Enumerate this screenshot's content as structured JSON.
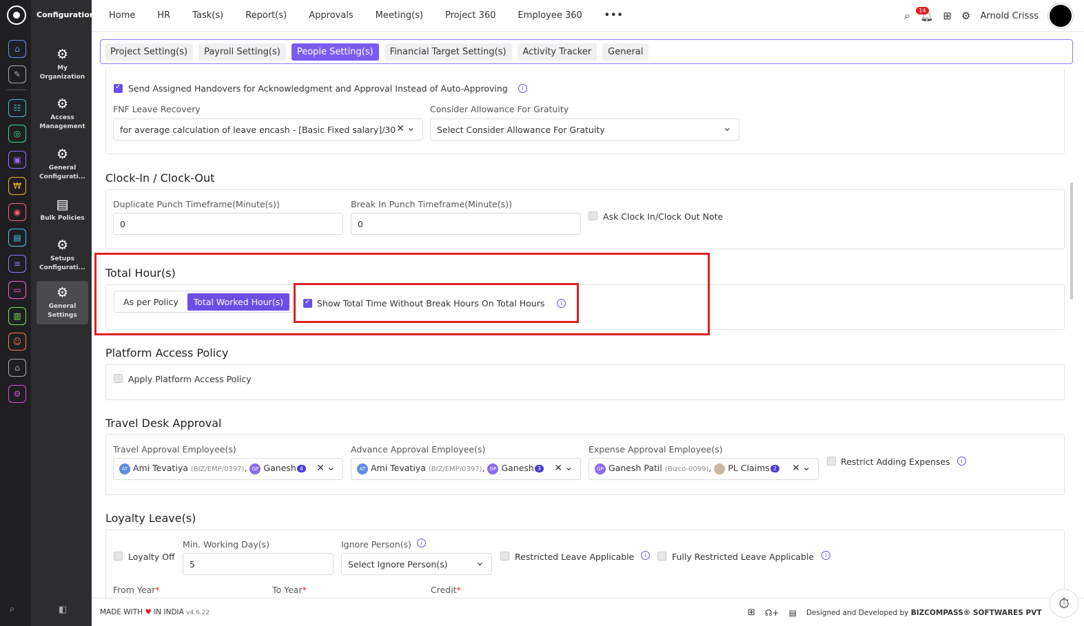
{
  "sidebar": {
    "title": "Configuration",
    "items": [
      {
        "label": "My Organization",
        "icon": "org-gear-icon"
      },
      {
        "label": "Access Management",
        "icon": "gear-icon"
      },
      {
        "label": "General Configurati...",
        "icon": "gear-icon"
      },
      {
        "label": "Bulk Policies",
        "icon": "document-gear-icon"
      },
      {
        "label": "Setups Configurati...",
        "icon": "gear-icon"
      },
      {
        "label": "General Settings",
        "icon": "org-gear-icon"
      }
    ]
  },
  "topnav": {
    "links": [
      "Home",
      "HR",
      "Task(s)",
      "Report(s)",
      "Approvals",
      "Meeting(s)",
      "Project 360",
      "Employee 360"
    ],
    "more": "•••",
    "notification_count": "14",
    "user_name": "Arnold Crisss"
  },
  "tabs": [
    "Project Setting(s)",
    "Payroll Setting(s)",
    "People Setting(s)",
    "Financial Target Setting(s)",
    "Activity Tracker",
    "General"
  ],
  "handover": {
    "send_assigned_label": "Send Assigned Handovers for Acknowledgment and Approval Instead of Auto-Approving",
    "fnf_label": "FNF Leave Recovery",
    "fnf_value": "for average calculation of leave encash - [Basic Fixed salary]/30",
    "gratuity_label": "Consider Allowance For Gratuity",
    "gratuity_placeholder": "Select Consider Allowance For Gratuity"
  },
  "clock": {
    "title": "Clock-In / Clock-Out",
    "dup_label": "Duplicate Punch Timeframe(Minute(s))",
    "dup_value": "0",
    "break_label": "Break In Punch Timeframe(Minute(s))",
    "break_value": "0",
    "ask_note_label": "Ask Clock In/Clock Out Note"
  },
  "total_hours": {
    "title": "Total Hour(s)",
    "option_policy": "As per Policy",
    "option_worked": "Total Worked Hour(s)",
    "show_total_label": "Show Total Time Without Break Hours On Total Hours"
  },
  "platform": {
    "title": "Platform Access Policy",
    "apply_label": "Apply Platform Access Policy"
  },
  "travel": {
    "title": "Travel Desk Approval",
    "travel_label": "Travel Approval Employee(s)",
    "advance_label": "Advance Approval Employee(s)",
    "expense_label": "Expense Approval Employee(s)",
    "emp1_initials": "AT",
    "emp1_name": "Ami Tevatiya",
    "emp1_code": "(BIZ/EMP/0397)",
    "emp2_initials": "GP",
    "emp2_name": "Ganesh",
    "travel_count": "4",
    "advance_count": "3",
    "exp1_name": "Ganesh Patil",
    "exp1_code": "(Bizco-0099)",
    "exp2_name": "PL Claims",
    "expense_count": "2",
    "restrict_label": "Restrict Adding Expenses"
  },
  "loyalty": {
    "title": "Loyalty Leave(s)",
    "off_label": "Loyalty Off",
    "min_label": "Min. Working Day(s)",
    "min_value": "5",
    "ignore_label": "Ignore Person(s)",
    "ignore_placeholder": "Select Ignore Person(s)",
    "restricted_label": "Restricted Leave Applicable",
    "fully_label": "Fully Restricted Leave Applicable",
    "from_label": "From Year",
    "to_label": "To Year",
    "credit_label": "Credit"
  },
  "footer": {
    "made_with": "MADE WITH",
    "in_india": "IN INDIA",
    "version": "v4.6.22",
    "designed": "Designed and Developed by",
    "company": "BIZCOMPASS® SOFTWARES PVT"
  },
  "colors": {
    "accent": "#6c4ee6",
    "highlight": "#e02020"
  }
}
